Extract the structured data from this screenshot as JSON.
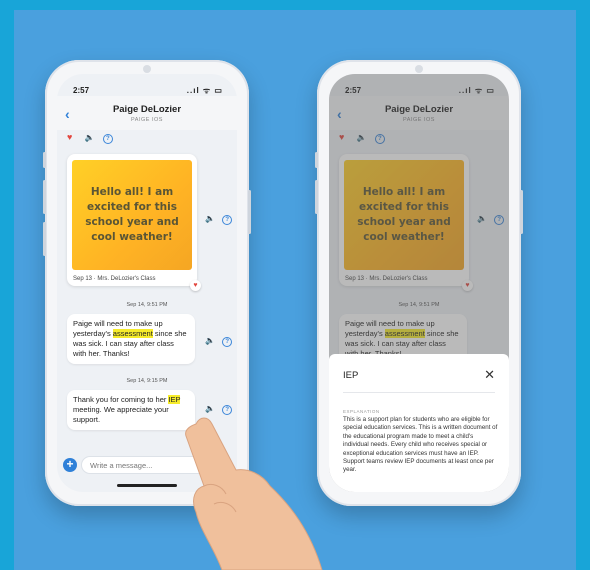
{
  "status": {
    "time": "2:57",
    "icons": "..ıl ᯤ ▭"
  },
  "conversation": {
    "name": "Paige DeLozier",
    "subtitle": "PAIGE IOS"
  },
  "card": {
    "text": "Hello all! I am excited for this school year and cool weather!",
    "caption": "Sep 13 · Mrs. DeLozier's Class"
  },
  "messages": [
    {
      "timestamp": "Sep 14, 9:51 PM",
      "text_before": "Paige will need to make up yesterday's ",
      "highlight": "assessment",
      "text_after": " since she was sick. I can stay after class with her. Thanks!"
    },
    {
      "timestamp": "Sep 14, 9:15 PM",
      "text_before": "Thank you for coming to her ",
      "highlight": "IEP",
      "text_after": " meeting. We appreciate your support."
    }
  ],
  "compose": {
    "placeholder": "Write a message..."
  },
  "sheet": {
    "title": "IEP",
    "close": "✕",
    "label": "EXPLANATION",
    "body": "This is a support plan for students who are eligible for special education services. This is a written document of the educational program made to meet a child's individual needs. Every child who receives special or exceptional education services must have an IEP. Support teams review IEP documents at least once per year."
  },
  "icons": {
    "heart": "heart-icon",
    "speaker": "speaker-icon",
    "help": "help-icon",
    "back": "back-chevron-icon",
    "plus": "plus-icon"
  },
  "colors": {
    "accent": "#2f80d8",
    "highlight": "#f6ec2b",
    "heart": "#e2473f",
    "background": "#4aa0de"
  }
}
